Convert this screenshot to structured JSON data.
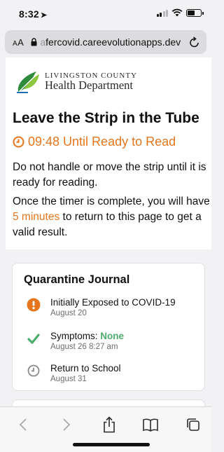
{
  "status_bar": {
    "time": "8:32",
    "location_arrow": "➤",
    "icons": [
      "signal-icon",
      "wifi-icon",
      "battery-icon"
    ]
  },
  "address_bar": {
    "aa_small": "A",
    "aa_large": "A",
    "url_faded": "a",
    "url": "fercovid.careevolutionapps.dev",
    "icons": [
      "lock-icon",
      "reload-icon"
    ]
  },
  "logo": {
    "line1": "LIVINGSTON COUNTY",
    "line2": "Health Department"
  },
  "page": {
    "heading": "Leave the Strip in the Tube",
    "timer": "09:48 Until Ready to Read",
    "paragraph1": "Do not handle or move the strip until it is ready for reading.",
    "paragraph2_before": "Once the timer is complete, you will have ",
    "paragraph2_highlight": "5 minutes",
    "paragraph2_after": " to return to this page to get a valid result."
  },
  "journal": {
    "title": "Quarantine Journal",
    "items": [
      {
        "title": "Initially Exposed to COVID-19",
        "date": "August 20",
        "icon": "alert-icon"
      },
      {
        "title_prefix": "Symptoms: ",
        "title_value": "None",
        "date": "August 26 8:27 am",
        "icon": "check-icon"
      },
      {
        "title": "Return to School",
        "date": "August 31",
        "icon": "clock-icon"
      }
    ]
  },
  "colors": {
    "accent": "#e6761d",
    "success": "#4cae6c"
  },
  "toolbar": {
    "icons": [
      "back-icon",
      "forward-icon",
      "share-icon",
      "bookmarks-icon",
      "tabs-icon"
    ]
  }
}
